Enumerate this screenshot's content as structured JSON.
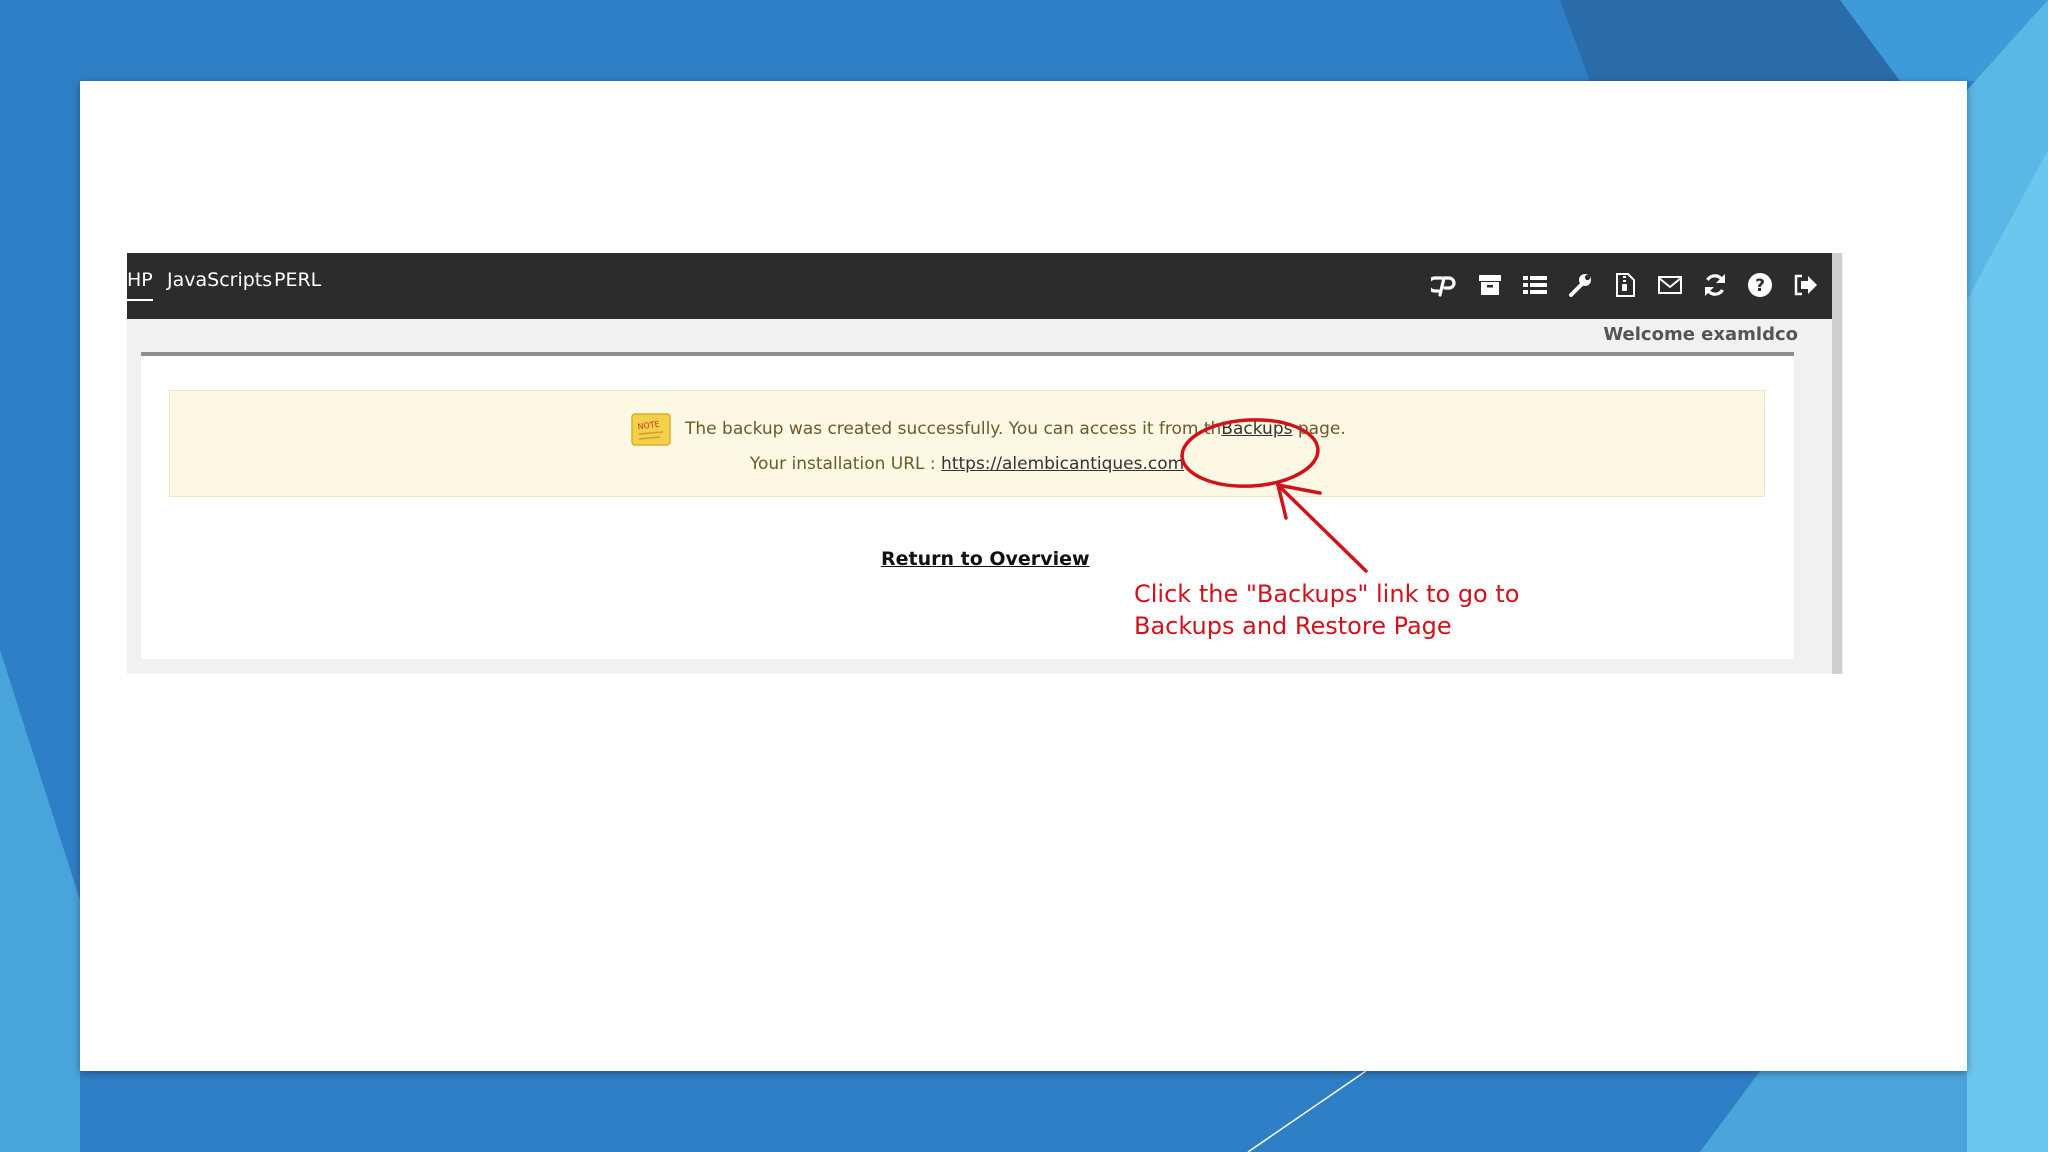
{
  "navbar": {
    "tabs": [
      {
        "label": "HP",
        "active": true
      },
      {
        "label": "JavaScripts",
        "active": false
      },
      {
        "label": "PERL",
        "active": false
      }
    ],
    "icons": [
      "cpanel-logo-icon",
      "archive-icon",
      "list-icon",
      "wrench-icon",
      "file-zip-icon",
      "envelope-icon",
      "refresh-icon",
      "help-icon",
      "logout-icon"
    ]
  },
  "welcome": "Welcome examldco",
  "note": {
    "message_prefix": "The backup was created successfully. You can access it from th",
    "link_label": "Backups",
    "message_suffix": " page.",
    "url_label": "Your installation URL : ",
    "url": "https://alembicantiques.com"
  },
  "return_link": "Return to Overview",
  "annotation": {
    "line1": "Click the \"Backups\" link to go to",
    "line2": "Backups and Restore Page",
    "color": "#d0121b"
  },
  "colors": {
    "navbar": "#2c2c2c",
    "note_background": "#fcf8e3",
    "slide_background": "#2f7fc6"
  }
}
